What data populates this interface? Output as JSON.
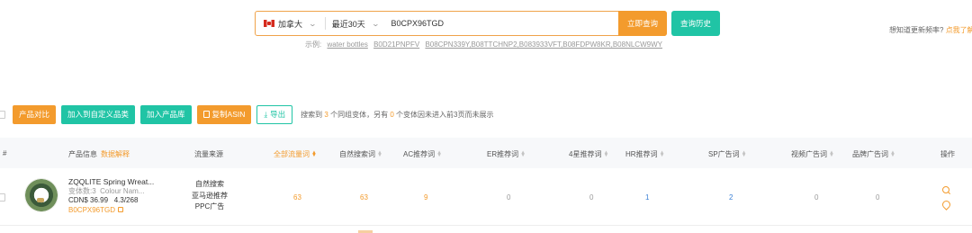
{
  "search": {
    "country": "加拿大",
    "period": "最近30天",
    "query": "B0CPX96TGD",
    "query_button": "立即查询",
    "history_button": "查询历史",
    "examples_label": "示例:",
    "examples": [
      "water bottles",
      "B0D21PNPFV",
      "B08CPN339Y,B08TTCHNP2,B083933VFT,B08FDPW8KR,B08NLCW9WY"
    ],
    "freq_text": "想知道更新频率?",
    "freq_link": "点我了解"
  },
  "toolbar": {
    "compare": "产品对比",
    "add_custom": "加入到自定义品类",
    "add_library": "加入产品库",
    "copy_asin": "复制ASIN",
    "export": "导出",
    "summary_pre": "搜索到",
    "summary_count": "3",
    "summary_mid": "个同组变体，另有",
    "summary_missing": "0",
    "summary_post": "个变体因未进入前3页而未展示"
  },
  "table": {
    "headers": {
      "index": "#",
      "product": "产品信息",
      "product_hint": "数据解释",
      "source": "流量来源",
      "all_traffic": "全部流量词",
      "organic": "自然搜索词",
      "ac": "AC推荐词",
      "er": "ER推荐词",
      "four_star": "4星推荐词",
      "hr": "HR推荐词",
      "sp": "SP广告词",
      "video": "视频广告词",
      "brand": "品牌广告词",
      "ops": "操作"
    },
    "rows": [
      {
        "name": "ZQQLITE Spring Wreat...",
        "variants": "变体数:3",
        "colour": "Colour Nam...",
        "price": "CDN$ 36.99",
        "rating": "4.3/268",
        "asin": "B0CPX96TGD",
        "sources": [
          "自然搜索",
          "亚马逊推荐",
          "PPC广告"
        ],
        "all_traffic": "63",
        "organic": "63",
        "ac": "9",
        "er": "0",
        "four_star": "0",
        "hr": "1",
        "sp": "2",
        "video": "0",
        "brand": "0"
      }
    ]
  },
  "colors": {
    "accent_orange": "#f39b2d",
    "accent_teal": "#20c4a5",
    "link_blue": "#3a7fd5"
  },
  "icons": [
    "canada-flag-icon",
    "chevron-down-icon",
    "copy-icon",
    "download-icon",
    "sort-icon",
    "external-link-icon",
    "search-icon",
    "location-pin-icon"
  ]
}
